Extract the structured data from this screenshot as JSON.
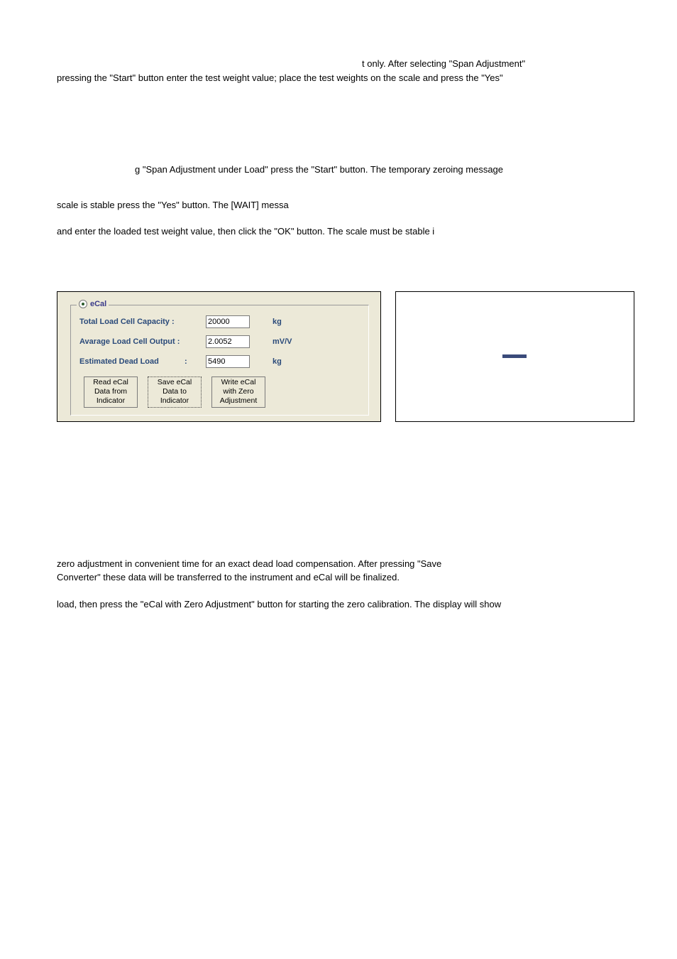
{
  "para1_a": "t only. After selecting \"Span Adjustment\"",
  "para1_b": "pressing the \"Start\" button  enter the test weight value; place the test weights on the scale and press the \"Yes\"",
  "para2": "g \"Span Adjustment under Load\" press the \"Start\" button. The temporary zeroing message",
  "para3": "scale is stable press the \"Yes\" button. The [WAIT] messa",
  "para4": "and enter the loaded test weight value, then click the \"OK\" button. The scale must be stable i",
  "ecal": {
    "legend": "eCal",
    "capacity_label": "Total Load Cell Capacity   :",
    "capacity_value": "20000",
    "capacity_unit": "kg",
    "output_label": "Avarage Load Cell Output :",
    "output_value": "2.0052",
    "output_unit": "mV/V",
    "deadload_label": "Estimated Dead Load",
    "deadload_colon": ":",
    "deadload_value": "5490",
    "deadload_unit": "kg",
    "btn_read": "Read eCal Data from Indicator",
    "btn_save": "Save eCal Data to Indicator",
    "btn_write": "Write eCal with Zero Adjustment"
  },
  "para5_a": "zero adjustment in convenient time for an exact dead load compensation. After pressing \"Save",
  "para5_b": "Converter\" these data will be transferred to the instrument and eCal will be finalized.",
  "para6": "load, then press the \"eCal with Zero Adjustment\" button for starting the zero calibration. The display will show"
}
